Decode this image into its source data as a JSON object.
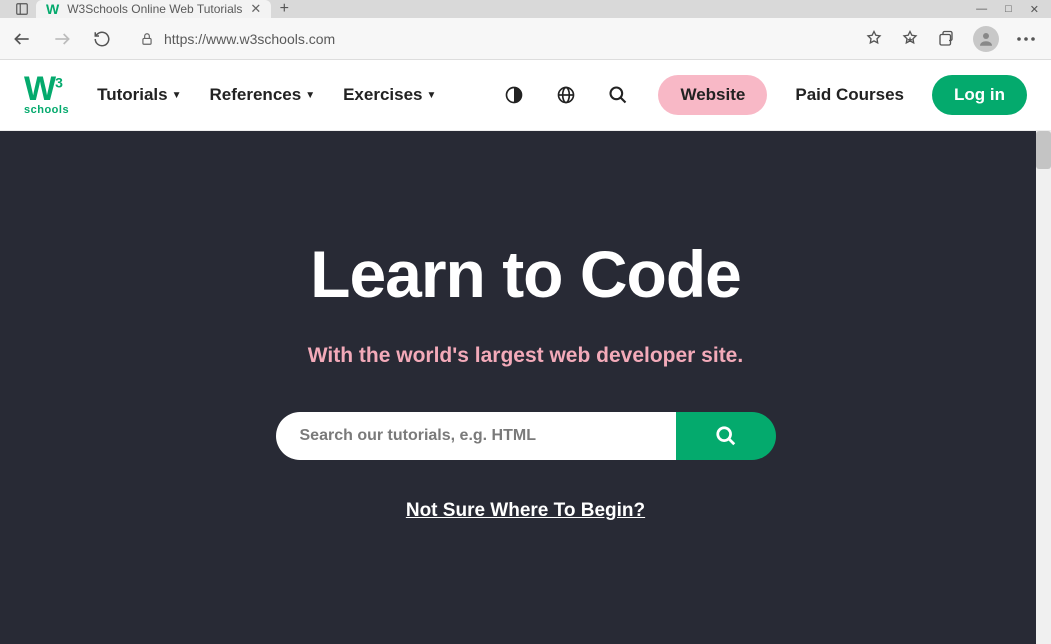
{
  "browser": {
    "tab_title": "W3Schools Online Web Tutorials",
    "url": "https://www.w3schools.com"
  },
  "nav": {
    "logo_sub": "schools",
    "items": [
      "Tutorials",
      "References",
      "Exercises"
    ],
    "website": "Website",
    "paid_courses": "Paid Courses",
    "login": "Log in"
  },
  "hero": {
    "title": "Learn to Code",
    "subtitle": "With the world's largest web developer site.",
    "search_placeholder": "Search our tutorials, e.g. HTML",
    "begin_link": "Not Sure Where To Begin?"
  }
}
